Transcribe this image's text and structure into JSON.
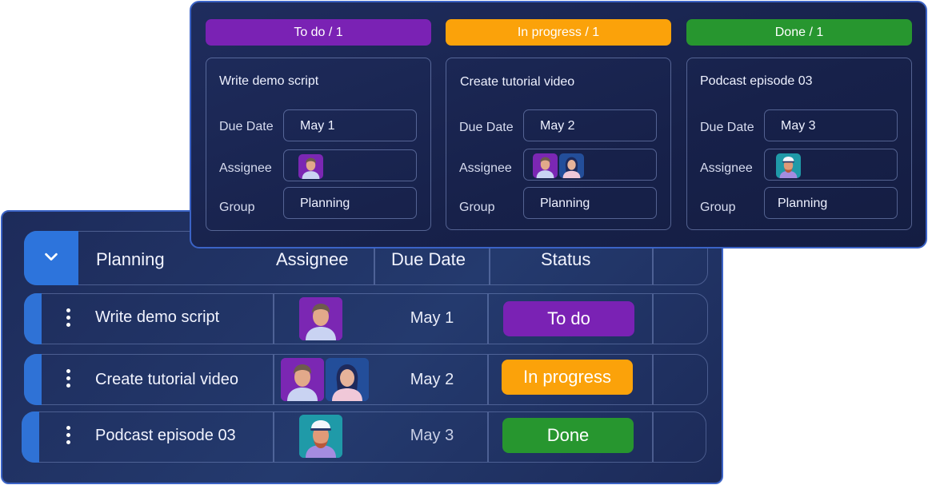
{
  "table": {
    "group_name": "Planning",
    "columns": {
      "assignee": "Assignee",
      "due_date": "Due Date",
      "status": "Status"
    },
    "rows": [
      {
        "name": "Write demo script",
        "due": "May 1",
        "status": "To do",
        "status_color": "#7a22b4"
      },
      {
        "name": "Create tutorial video",
        "due": "May 2",
        "status": "In progress",
        "status_color": "#fba20a"
      },
      {
        "name": "Podcast episode 03",
        "due": "May 3",
        "status": "Done",
        "status_color": "#27962f"
      }
    ]
  },
  "kanban": {
    "columns": [
      {
        "header": "To do / 1",
        "color": "#7a22b4",
        "card": {
          "title": "Write demo script",
          "due_label": "Due Date",
          "due": "May 1",
          "assignee_label": "Assignee",
          "group_label": "Group",
          "group": "Planning"
        }
      },
      {
        "header": "In progress / 1",
        "color": "#fba20a",
        "card": {
          "title": "Create tutorial video",
          "due_label": "Due Date",
          "due": "May 2",
          "assignee_label": "Assignee",
          "group_label": "Group",
          "group": "Planning"
        }
      },
      {
        "header": "Done / 1",
        "color": "#27962f",
        "card": {
          "title": "Podcast episode 03",
          "due_label": "Due Date",
          "due": "May 3",
          "assignee_label": "Assignee",
          "group_label": "Group",
          "group": "Planning"
        }
      }
    ]
  },
  "icons": {
    "collapse": "chevron-down-icon",
    "row_menu": "kebab-menu-icon",
    "avatars": [
      "avatar-man-purple",
      "avatar-woman-blue",
      "avatar-man-cap-teal"
    ]
  }
}
